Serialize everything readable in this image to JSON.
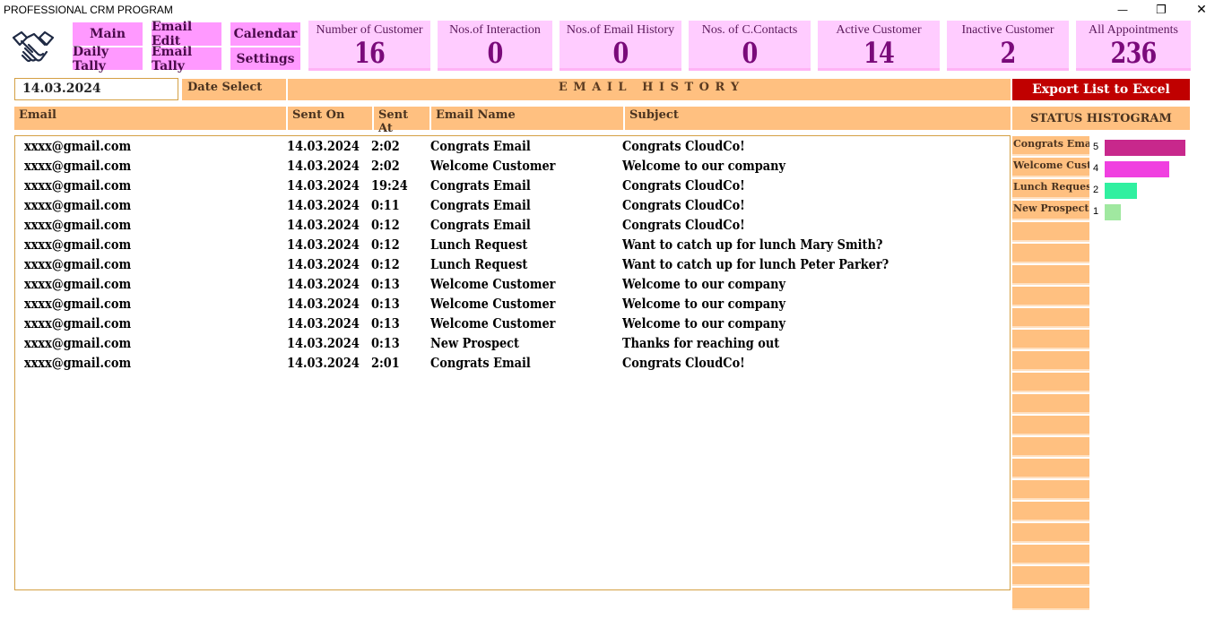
{
  "window": {
    "title": "PROFESSIONAL CRM PROGRAM",
    "minimize_glyph": "—",
    "restore_glyph": "❐",
    "close_glyph": "✕"
  },
  "logo": {
    "icon": "handshake-icon"
  },
  "nav": {
    "main": "Main",
    "daily_tally": "Daily Tally",
    "email_edit": "Email Edit",
    "email_tally": "Email Tally",
    "calendar": "Calendar",
    "settings": "Settings"
  },
  "stats": [
    {
      "label": "Number of Customer",
      "value": "16"
    },
    {
      "label": "Nos.of Interaction",
      "value": "0"
    },
    {
      "label": "Nos.of Email History",
      "value": "0"
    },
    {
      "label": "Nos. of C.Contacts",
      "value": "0"
    },
    {
      "label": "Active Customer",
      "value": "14"
    },
    {
      "label": "Inactive Customer",
      "value": "2"
    },
    {
      "label": "All Appointments",
      "value": "236"
    }
  ],
  "date_input": {
    "value": "14.03.2024"
  },
  "date_select_label": "Date Select",
  "section_title": "E M A I L   H I S T O R Y",
  "export_button": "Export List to Excel",
  "columns": {
    "email": "Email",
    "sent_on": "Sent On",
    "sent_at": "Sent At",
    "email_name": "Email Name",
    "subject": "Subject"
  },
  "histogram_title": "STATUS HISTOGRAM",
  "rows": [
    {
      "email": "xxxx@gmail.com",
      "sent_on": "14.03.2024",
      "sent_at": "2:02",
      "email_name": "Congrats Email",
      "subject": "Congrats CloudCo!"
    },
    {
      "email": "xxxx@gmail.com",
      "sent_on": "14.03.2024",
      "sent_at": "2:02",
      "email_name": "Welcome Customer",
      "subject": "Welcome to our company"
    },
    {
      "email": "xxxx@gmail.com",
      "sent_on": "14.03.2024",
      "sent_at": "19:24",
      "email_name": "Congrats Email",
      "subject": "Congrats CloudCo!"
    },
    {
      "email": "xxxx@gmail.com",
      "sent_on": "14.03.2024",
      "sent_at": "0:11",
      "email_name": "Congrats Email",
      "subject": "Congrats CloudCo!"
    },
    {
      "email": "xxxx@gmail.com",
      "sent_on": "14.03.2024",
      "sent_at": "0:12",
      "email_name": "Congrats Email",
      "subject": "Congrats CloudCo!"
    },
    {
      "email": "xxxx@gmail.com",
      "sent_on": "14.03.2024",
      "sent_at": "0:12",
      "email_name": "Lunch Request",
      "subject": "Want to catch up for lunch Mary Smith?"
    },
    {
      "email": "xxxx@gmail.com",
      "sent_on": "14.03.2024",
      "sent_at": "0:12",
      "email_name": "Lunch Request",
      "subject": "Want to catch up for lunch Peter Parker?"
    },
    {
      "email": "xxxx@gmail.com",
      "sent_on": "14.03.2024",
      "sent_at": "0:13",
      "email_name": "Welcome Customer",
      "subject": "Welcome to our company"
    },
    {
      "email": "xxxx@gmail.com",
      "sent_on": "14.03.2024",
      "sent_at": "0:13",
      "email_name": "Welcome Customer",
      "subject": "Welcome to our company"
    },
    {
      "email": "xxxx@gmail.com",
      "sent_on": "14.03.2024",
      "sent_at": "0:13",
      "email_name": "Welcome Customer",
      "subject": "Welcome to our company"
    },
    {
      "email": "xxxx@gmail.com",
      "sent_on": "14.03.2024",
      "sent_at": "0:13",
      "email_name": "New Prospect",
      "subject": "Thanks for reaching out"
    },
    {
      "email": "xxxx@gmail.com",
      "sent_on": "14.03.2024",
      "sent_at": "2:01",
      "email_name": "Congrats Email",
      "subject": "Congrats CloudCo!"
    }
  ],
  "histogram": {
    "max": 5,
    "items": [
      {
        "label": "Congrats Email",
        "value": 5,
        "color": "#c8288c"
      },
      {
        "label": "Welcome Customer",
        "value": 4,
        "color": "#f040e0"
      },
      {
        "label": "Lunch Request",
        "value": 2,
        "color": "#30f0a0"
      },
      {
        "label": "New Prospect",
        "value": 1,
        "color": "#a0e8a0"
      }
    ]
  }
}
